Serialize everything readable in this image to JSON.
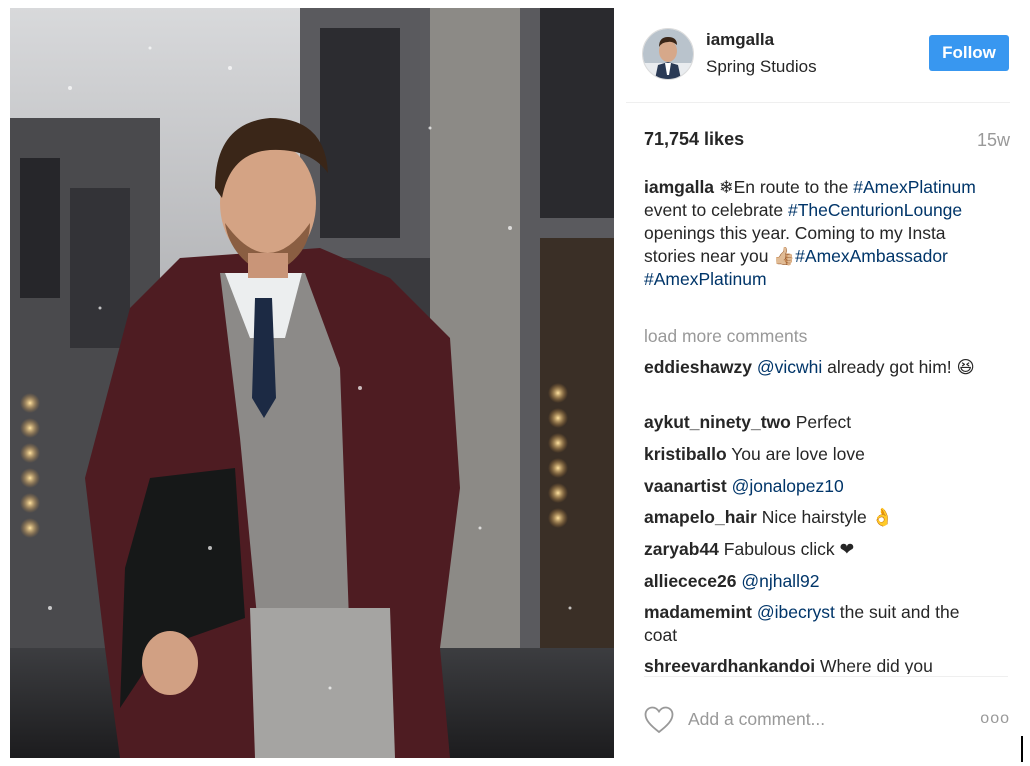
{
  "post": {
    "username": "iamgalla",
    "location": "Spring Studios",
    "follow_label": "Follow",
    "likes": "71,754 likes",
    "time": "15w",
    "caption": {
      "username": "iamgalla",
      "text1": " ❄En route to the ",
      "tag1": "#AmexPlatinum",
      "text2": " event to celebrate ",
      "tag2": "#TheCenturionLounge",
      "text3": " openings this year. Coming to my Insta stories near you 👍🏼",
      "tag3": "#AmexAmbassador",
      "text4": " ",
      "tag4": "#AmexPlatinum"
    },
    "load_more": "load more comments",
    "comments": [
      {
        "user": "eddieshawzy",
        "mention": "@vicwhi",
        "text": " already got him! 😆"
      },
      {
        "user": "aykut_ninety_two",
        "mention": "",
        "text": " Perfect"
      },
      {
        "user": "kristiballo",
        "mention": "",
        "text": " You are love love"
      },
      {
        "user": "vaanartist",
        "mention": "@jonalopez10",
        "text": ""
      },
      {
        "user": "amapelo_hair",
        "mention": "",
        "text": " Nice hairstyle 👌"
      },
      {
        "user": "zaryab44",
        "mention": "",
        "text": " Fabulous click ❤"
      },
      {
        "user": "alliecece26",
        "mention": "@njhall92",
        "text": ""
      },
      {
        "user": "madamemint",
        "mention": "@ibecryst",
        "text": " the suit and the coat"
      },
      {
        "user": "shreevardhankandoi",
        "mention": "",
        "text": " Where did you"
      }
    ],
    "add_comment_placeholder": "Add a comment...",
    "more_label": "ooo"
  },
  "colors": {
    "follow_bg": "#3897f0",
    "link": "#003569",
    "muted": "#999999"
  }
}
